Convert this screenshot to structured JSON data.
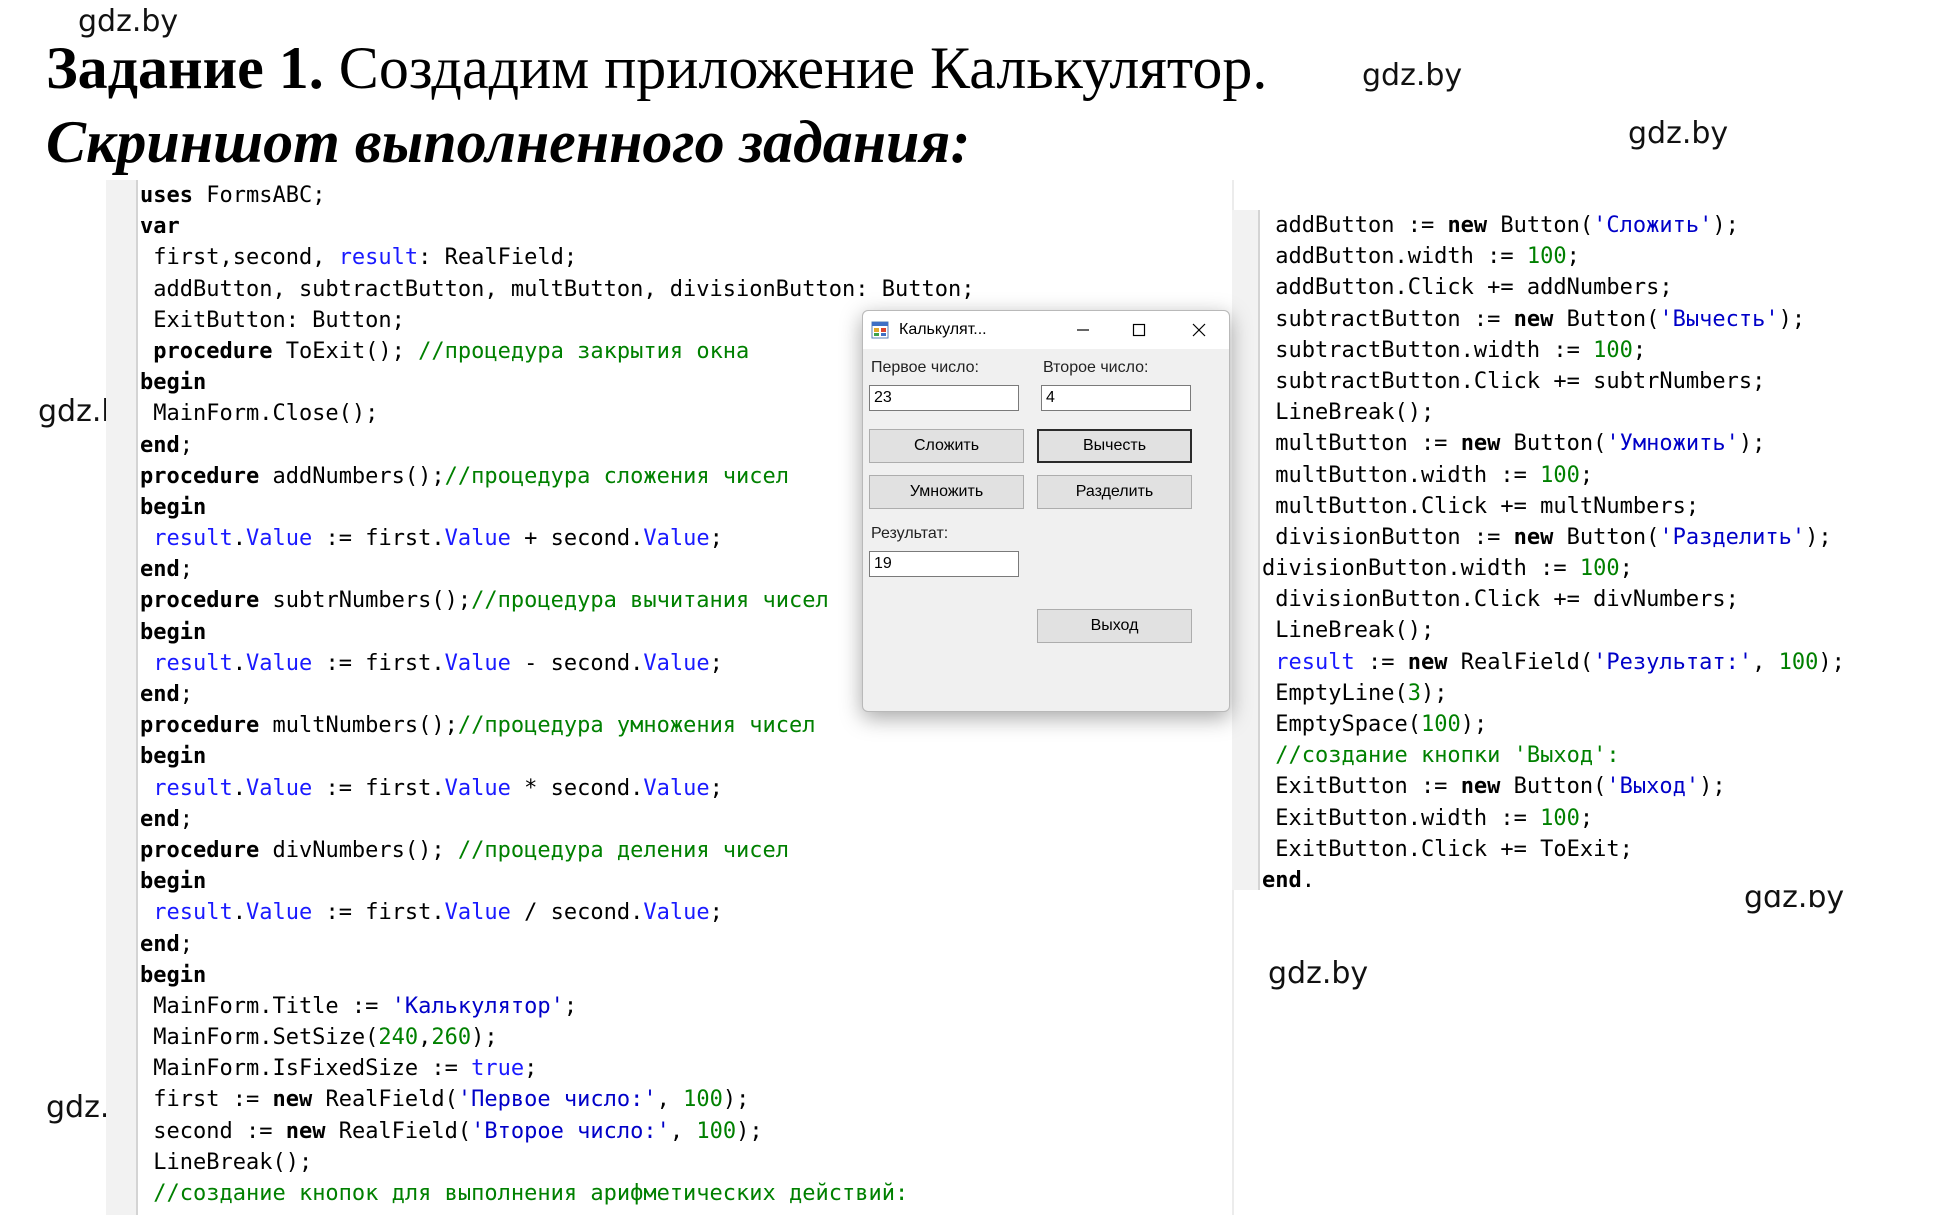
{
  "watermark": "gdz.by",
  "task": {
    "number": "Задание 1.",
    "text": " Создадим приложение Калькулятор."
  },
  "subtitle": "Скриншот выполненного задания:",
  "code_left": [
    [
      [
        "kw",
        "uses"
      ],
      [
        "t",
        " FormsABC;"
      ]
    ],
    [
      [
        "kw",
        "var"
      ]
    ],
    [
      [
        "t",
        " first,second, "
      ],
      [
        "id",
        "result"
      ],
      [
        "t",
        ": RealField;"
      ]
    ],
    [
      [
        "t",
        " addButton, subtractButton, multButton, divisionButton: Button;"
      ]
    ],
    [
      [
        "t",
        " ExitButton: Button;"
      ]
    ],
    [
      [
        "t",
        " "
      ],
      [
        "kw",
        "procedure"
      ],
      [
        "t",
        " ToExit(); "
      ],
      [
        "cm",
        "//процедура закрытия окна"
      ]
    ],
    [
      [
        "kw",
        "begin"
      ]
    ],
    [
      [
        "t",
        " MainForm.Close();"
      ]
    ],
    [
      [
        "kw",
        "end"
      ],
      [
        "t",
        ";"
      ]
    ],
    [
      [
        "kw",
        "procedure"
      ],
      [
        "t",
        " addNumbers();"
      ],
      [
        "cm",
        "//процедура сложения чисел"
      ]
    ],
    [
      [
        "kw",
        "begin"
      ]
    ],
    [
      [
        "t",
        " "
      ],
      [
        "id",
        "result"
      ],
      [
        "t",
        "."
      ],
      [
        "id",
        "Value"
      ],
      [
        "t",
        " := first."
      ],
      [
        "id",
        "Value"
      ],
      [
        "t",
        " + second."
      ],
      [
        "id",
        "Value"
      ],
      [
        "t",
        ";"
      ]
    ],
    [
      [
        "kw",
        "end"
      ],
      [
        "t",
        ";"
      ]
    ],
    [
      [
        "kw",
        "procedure"
      ],
      [
        "t",
        " subtrNumbers();"
      ],
      [
        "cm",
        "//процедура вычитания чисел"
      ]
    ],
    [
      [
        "kw",
        "begin"
      ]
    ],
    [
      [
        "t",
        " "
      ],
      [
        "id",
        "result"
      ],
      [
        "t",
        "."
      ],
      [
        "id",
        "Value"
      ],
      [
        "t",
        " := first."
      ],
      [
        "id",
        "Value"
      ],
      [
        "t",
        " - second."
      ],
      [
        "id",
        "Value"
      ],
      [
        "t",
        ";"
      ]
    ],
    [
      [
        "kw",
        "end"
      ],
      [
        "t",
        ";"
      ]
    ],
    [
      [
        "kw",
        "procedure"
      ],
      [
        "t",
        " multNumbers();"
      ],
      [
        "cm",
        "//процедура умножения чисел"
      ]
    ],
    [
      [
        "kw",
        "begin"
      ]
    ],
    [
      [
        "t",
        " "
      ],
      [
        "id",
        "result"
      ],
      [
        "t",
        "."
      ],
      [
        "id",
        "Value"
      ],
      [
        "t",
        " := first."
      ],
      [
        "id",
        "Value"
      ],
      [
        "t",
        " * second."
      ],
      [
        "id",
        "Value"
      ],
      [
        "t",
        ";"
      ]
    ],
    [
      [
        "kw",
        "end"
      ],
      [
        "t",
        ";"
      ]
    ],
    [
      [
        "kw",
        "procedure"
      ],
      [
        "t",
        " divNumbers(); "
      ],
      [
        "cm",
        "//процедура деления чисел"
      ]
    ],
    [
      [
        "kw",
        "begin"
      ]
    ],
    [
      [
        "t",
        " "
      ],
      [
        "id",
        "result"
      ],
      [
        "t",
        "."
      ],
      [
        "id",
        "Value"
      ],
      [
        "t",
        " := first."
      ],
      [
        "id",
        "Value"
      ],
      [
        "t",
        " / second."
      ],
      [
        "id",
        "Value"
      ],
      [
        "t",
        ";"
      ]
    ],
    [
      [
        "kw",
        "end"
      ],
      [
        "t",
        ";"
      ]
    ],
    [
      [
        "kw",
        "begin"
      ]
    ],
    [
      [
        "t",
        " MainForm.Title := "
      ],
      [
        "str",
        "'Калькулятор'"
      ],
      [
        "t",
        ";"
      ]
    ],
    [
      [
        "t",
        " MainForm.SetSize("
      ],
      [
        "num",
        "240"
      ],
      [
        "t",
        ","
      ],
      [
        "num",
        "260"
      ],
      [
        "t",
        ");"
      ]
    ],
    [
      [
        "t",
        " MainForm.IsFixedSize := "
      ],
      [
        "id",
        "true"
      ],
      [
        "t",
        ";"
      ]
    ],
    [
      [
        "t",
        " first := "
      ],
      [
        "kw",
        "new"
      ],
      [
        "t",
        " RealField("
      ],
      [
        "str",
        "'Первое число:'"
      ],
      [
        "t",
        ", "
      ],
      [
        "num",
        "100"
      ],
      [
        "t",
        ");"
      ]
    ],
    [
      [
        "t",
        " second := "
      ],
      [
        "kw",
        "new"
      ],
      [
        "t",
        " RealField("
      ],
      [
        "str",
        "'Второе число:'"
      ],
      [
        "t",
        ", "
      ],
      [
        "num",
        "100"
      ],
      [
        "t",
        ");"
      ]
    ],
    [
      [
        "t",
        " LineBreak();"
      ]
    ],
    [
      [
        "t",
        " "
      ],
      [
        "cm",
        "//создание кнопок для выполнения арифметических действий:"
      ]
    ]
  ],
  "code_right": [
    [
      [
        "t",
        " addButton := "
      ],
      [
        "kw",
        "new"
      ],
      [
        "t",
        " Button("
      ],
      [
        "str",
        "'Сложить'"
      ],
      [
        "t",
        ");"
      ]
    ],
    [
      [
        "t",
        " addButton.width := "
      ],
      [
        "num",
        "100"
      ],
      [
        "t",
        ";"
      ]
    ],
    [
      [
        "t",
        " addButton.Click += addNumbers;"
      ]
    ],
    [
      [
        "t",
        " subtractButton := "
      ],
      [
        "kw",
        "new"
      ],
      [
        "t",
        " Button("
      ],
      [
        "str",
        "'Вычесть'"
      ],
      [
        "t",
        ");"
      ]
    ],
    [
      [
        "t",
        " subtractButton.width := "
      ],
      [
        "num",
        "100"
      ],
      [
        "t",
        ";"
      ]
    ],
    [
      [
        "t",
        " subtractButton.Click += subtrNumbers;"
      ]
    ],
    [
      [
        "t",
        " LineBreak();"
      ]
    ],
    [
      [
        "t",
        " multButton := "
      ],
      [
        "kw",
        "new"
      ],
      [
        "t",
        " Button("
      ],
      [
        "str",
        "'Умножить'"
      ],
      [
        "t",
        ");"
      ]
    ],
    [
      [
        "t",
        " multButton.width := "
      ],
      [
        "num",
        "100"
      ],
      [
        "t",
        ";"
      ]
    ],
    [
      [
        "t",
        " multButton.Click += multNumbers;"
      ]
    ],
    [
      [
        "t",
        " divisionButton := "
      ],
      [
        "kw",
        "new"
      ],
      [
        "t",
        " Button("
      ],
      [
        "str",
        "'Разделить'"
      ],
      [
        "t",
        ");"
      ]
    ],
    [
      [
        "t",
        "divisionButton.width := "
      ],
      [
        "num",
        "100"
      ],
      [
        "t",
        ";"
      ]
    ],
    [
      [
        "t",
        " divisionButton.Click += divNumbers;"
      ]
    ],
    [
      [
        "t",
        " LineBreak();"
      ]
    ],
    [
      [
        "t",
        " "
      ],
      [
        "id",
        "result"
      ],
      [
        "t",
        " := "
      ],
      [
        "kw",
        "new"
      ],
      [
        "t",
        " RealField("
      ],
      [
        "str",
        "'Результат:'"
      ],
      [
        "t",
        ", "
      ],
      [
        "num",
        "100"
      ],
      [
        "t",
        ");"
      ]
    ],
    [
      [
        "t",
        " EmptyLine("
      ],
      [
        "num",
        "3"
      ],
      [
        "t",
        ");"
      ]
    ],
    [
      [
        "t",
        " EmptySpace("
      ],
      [
        "num",
        "100"
      ],
      [
        "t",
        ");"
      ]
    ],
    [
      [
        "t",
        " "
      ],
      [
        "cm",
        "//создание кнопки 'Выход':"
      ]
    ],
    [
      [
        "t",
        " ExitButton := "
      ],
      [
        "kw",
        "new"
      ],
      [
        "t",
        " Button("
      ],
      [
        "str",
        "'Выход'"
      ],
      [
        "t",
        ");"
      ]
    ],
    [
      [
        "t",
        " ExitButton.width := "
      ],
      [
        "num",
        "100"
      ],
      [
        "t",
        ";"
      ]
    ],
    [
      [
        "t",
        " ExitButton.Click += ToExit;"
      ]
    ],
    [
      [
        "kw",
        "end"
      ],
      [
        "t",
        "."
      ]
    ]
  ],
  "calc": {
    "title": "Калькулят...",
    "first_label": "Первое число:",
    "first_value": "23",
    "second_label": "Второе число:",
    "second_value": "4",
    "btn_add": "Сложить",
    "btn_sub": "Вычесть",
    "btn_mul": "Умножить",
    "btn_div": "Разделить",
    "result_label": "Результат:",
    "result_value": "19",
    "btn_exit": "Выход"
  }
}
